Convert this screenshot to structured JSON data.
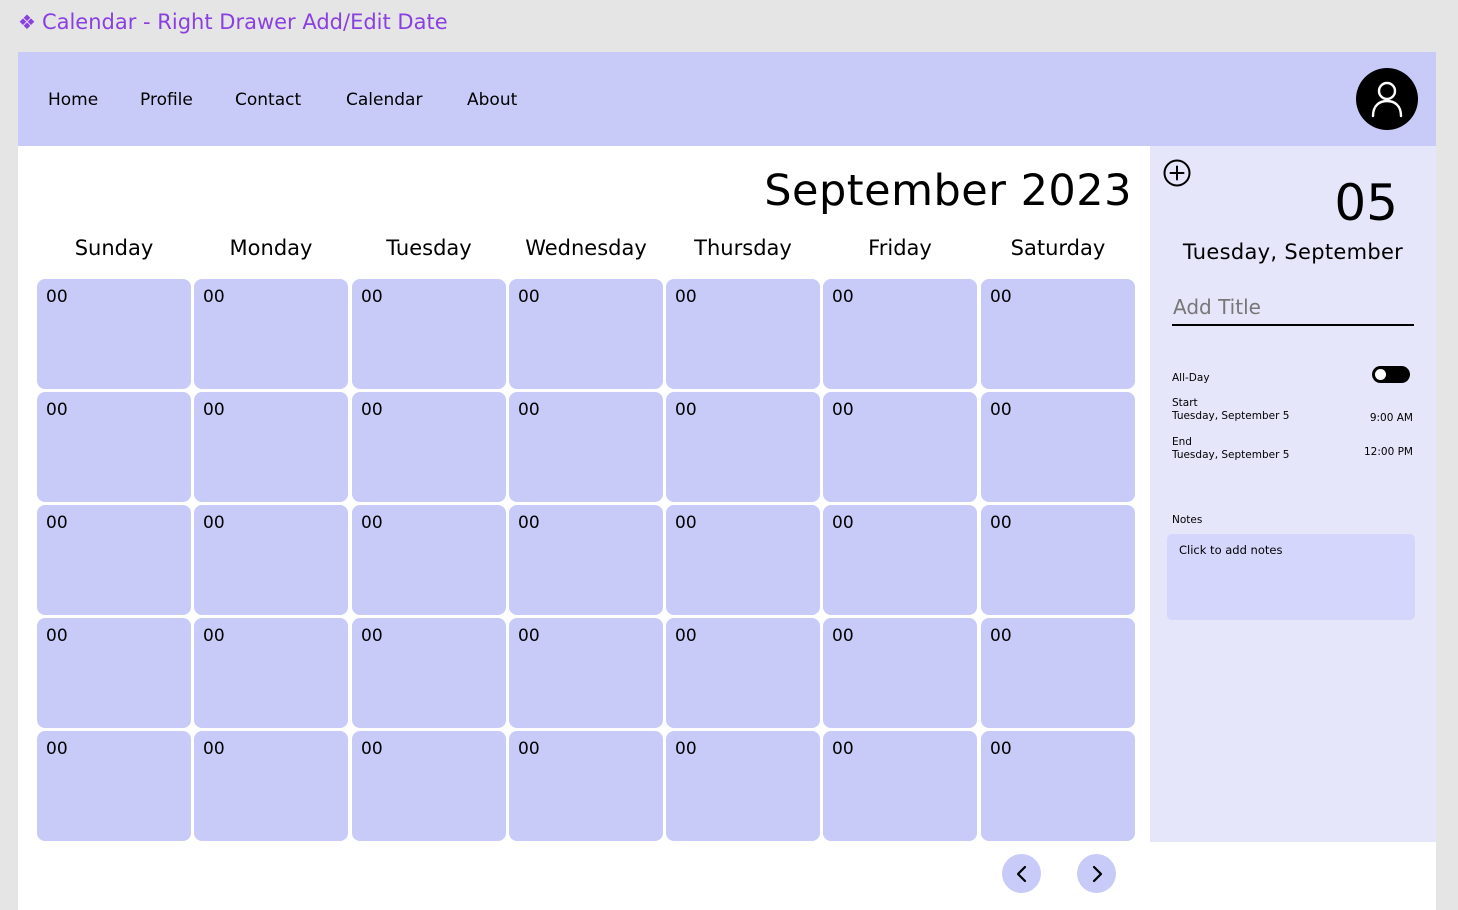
{
  "frame_label": "Calendar - Right Drawer Add/Edit Date",
  "nav": {
    "items": [
      "Home",
      "Profile",
      "Contact",
      "Calendar",
      "About"
    ]
  },
  "month_title": "September 2023",
  "weekdays": [
    "Sunday",
    "Monday",
    "Tuesday",
    "Wednesday",
    "Thursday",
    "Friday",
    "Saturday"
  ],
  "grid": {
    "rows": [
      [
        "00",
        "00",
        "00",
        "00",
        "00",
        "00",
        "00"
      ],
      [
        "00",
        "00",
        "00",
        "00",
        "00",
        "00",
        "00"
      ],
      [
        "00",
        "00",
        "00",
        "00",
        "00",
        "00",
        "00"
      ],
      [
        "00",
        "00",
        "00",
        "00",
        "00",
        "00",
        "00"
      ],
      [
        "00",
        "00",
        "00",
        "00",
        "00",
        "00",
        "00"
      ]
    ]
  },
  "drawer": {
    "day_number": "05",
    "date_label": "Tuesday, September",
    "title_placeholder": "Add Title",
    "all_day_label": "All-Day",
    "all_day_on": true,
    "start_label": "Start",
    "start_date": "Tuesday, September 5",
    "start_time": "9:00 AM",
    "end_label": "End",
    "end_date": "Tuesday, September 5",
    "end_time": "12:00 PM",
    "notes_label": "Notes",
    "notes_placeholder": "Click to add notes"
  },
  "colors": {
    "accent": "#c8cbf8",
    "drawer_bg": "#e6e6fb",
    "frame_label": "#8a3fe0"
  },
  "icons": {
    "frame": "diamond-component-icon",
    "avatar": "user-icon",
    "add": "plus-circle-icon",
    "prev": "chevron-left-icon",
    "next": "chevron-right-icon"
  }
}
